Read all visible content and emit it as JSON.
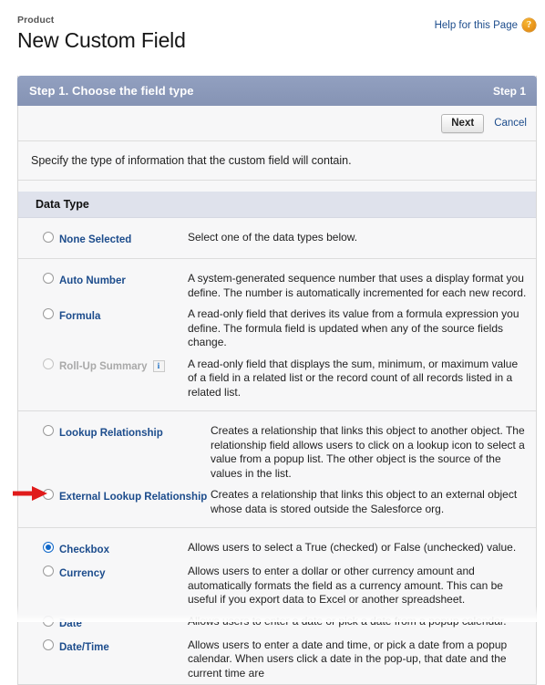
{
  "header": {
    "object_label": "Product",
    "title": "New Custom Field",
    "help_link": "Help for this Page",
    "help_icon": "question-mark-circle-icon"
  },
  "panel": {
    "step_title": "Step 1. Choose the field type",
    "step_indicator": "Step 1",
    "next_button": "Next",
    "cancel_link": "Cancel",
    "instruction": "Specify the type of information that the custom field will contain.",
    "section_title": "Data Type"
  },
  "colors": {
    "panel_header": "#8895b8",
    "section_band": "#dfe2ec",
    "link_blue": "#1c4c8c",
    "radio_selected": "#1168c9",
    "annotation_red": "#e01b1b",
    "help_icon_orange": "#e8941a"
  },
  "groups": [
    {
      "options": [
        {
          "label": "None Selected",
          "selected": false,
          "disabled": false,
          "info": false,
          "description": "Select one of the data types below."
        }
      ]
    },
    {
      "options": [
        {
          "label": "Auto Number",
          "selected": false,
          "disabled": false,
          "info": false,
          "description": "A system-generated sequence number that uses a display format you define. The number is automatically incremented for each new record."
        },
        {
          "label": "Formula",
          "selected": false,
          "disabled": false,
          "info": false,
          "description": "A read-only field that derives its value from a formula expression you define. The formula field is updated when any of the source fields change."
        },
        {
          "label": "Roll-Up Summary",
          "selected": false,
          "disabled": true,
          "info": true,
          "info_icon": "info-i-icon",
          "description": "A read-only field that displays the sum, minimum, or maximum value of a field in a related list or the record count of all records listed in a related list."
        }
      ]
    },
    {
      "options": [
        {
          "label": "Lookup Relationship",
          "selected": false,
          "disabled": false,
          "info": false,
          "description": "Creates a relationship that links this object to another object. The relationship field allows users to click on a lookup icon to select a value from a popup list. The other object is the source of the values in the list."
        },
        {
          "label": "External Lookup Relationship",
          "selected": false,
          "disabled": false,
          "info": false,
          "description": "Creates a relationship that links this object to an external object whose data is stored outside the Salesforce org."
        }
      ]
    },
    {
      "options": [
        {
          "label": "Checkbox",
          "selected": true,
          "disabled": false,
          "info": false,
          "description": "Allows users to select a True (checked) or False (unchecked) value."
        },
        {
          "label": "Currency",
          "selected": false,
          "disabled": false,
          "info": false,
          "description": "Allows users to enter a dollar or other currency amount and automatically formats the field as a currency amount. This can be useful if you export data to Excel or another spreadsheet."
        },
        {
          "label": "Date",
          "selected": false,
          "disabled": false,
          "info": false,
          "description": "Allows users to enter a date or pick a date from a popup calendar."
        },
        {
          "label": "Date/Time",
          "selected": false,
          "disabled": false,
          "info": false,
          "description": "Allows users to enter a date and time, or pick a date from a popup calendar. When users click a date in the pop-up, that date and the current time are"
        }
      ]
    }
  ],
  "annotation": {
    "arrow": "red-right-arrow-pointing-at-checkbox-radio"
  }
}
